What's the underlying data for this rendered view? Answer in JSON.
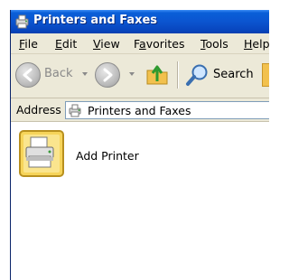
{
  "window": {
    "title": "Printers and Faxes"
  },
  "menu": [
    {
      "label": "File",
      "accel": "F",
      "rest": "ile"
    },
    {
      "label": "Edit",
      "accel": "E",
      "rest": "dit"
    },
    {
      "label": "View",
      "accel": "V",
      "rest": "iew"
    },
    {
      "label": "Favorites",
      "accel": "a",
      "pre": "F",
      "rest": "vorites"
    },
    {
      "label": "Tools",
      "accel": "T",
      "rest": "ools"
    },
    {
      "label": "Help",
      "accel": "H",
      "rest": "elp"
    }
  ],
  "toolbar": {
    "back_label": "Back",
    "search_label": "Search",
    "icons": [
      "back-arrow-icon",
      "forward-arrow-icon",
      "up-folder-icon",
      "search-magnifier-icon",
      "folders-icon"
    ]
  },
  "address": {
    "label": "Address",
    "value": "Printers and Faxes"
  },
  "items": [
    {
      "label": "Add Printer",
      "icon": "add-printer-icon"
    }
  ],
  "colors": {
    "titlebar": "#0b55d0",
    "chrome": "#ece9d8",
    "accent_gold": "#f2c14e"
  }
}
